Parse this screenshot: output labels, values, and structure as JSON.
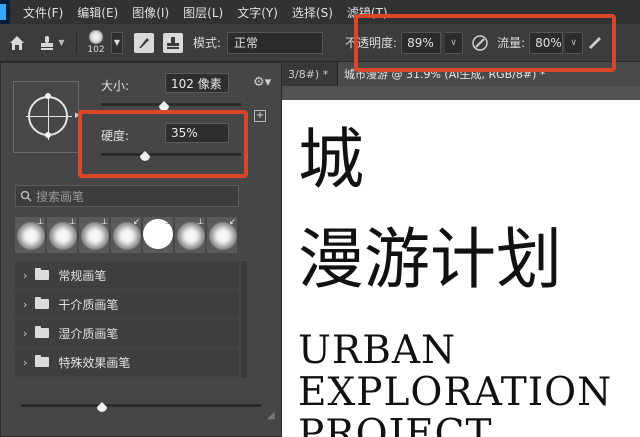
{
  "menu": [
    "文件(F)",
    "编辑(E)",
    "图像(I)",
    "图层(L)",
    "文字(Y)",
    "选择(S)",
    "滤镜(T)"
  ],
  "options": {
    "brush_size": "102",
    "mode_label": "模式:",
    "mode_value": "正常",
    "opacity_label": "不透明度:",
    "opacity_value": "89%",
    "flow_label": "流量:",
    "flow_value": "80%"
  },
  "tabs": [
    "3/8#) *",
    "城市漫游 @ 31.9% (AI生成, RGB/8#) *"
  ],
  "canvas": {
    "line1": "城",
    "line2": "漫游计划",
    "line3": "URBAN",
    "line4": "EXPLORATION",
    "line5": "PROJECT"
  },
  "panel": {
    "size_label": "大小:",
    "size_value": "102 像素",
    "hardness_label": "硬度:",
    "hardness_value": "35%",
    "search_placeholder": "搜索画笔",
    "groups": [
      "常规画笔",
      "干介质画笔",
      "湿介质画笔",
      "特殊效果画笔"
    ]
  },
  "colors": {
    "highlight": "#d9472b",
    "panel_bg": "#464646",
    "menubar_bg": "#323232",
    "optionsbar_bg": "#3c3c3c",
    "canvas_bg": "#ffffff"
  }
}
